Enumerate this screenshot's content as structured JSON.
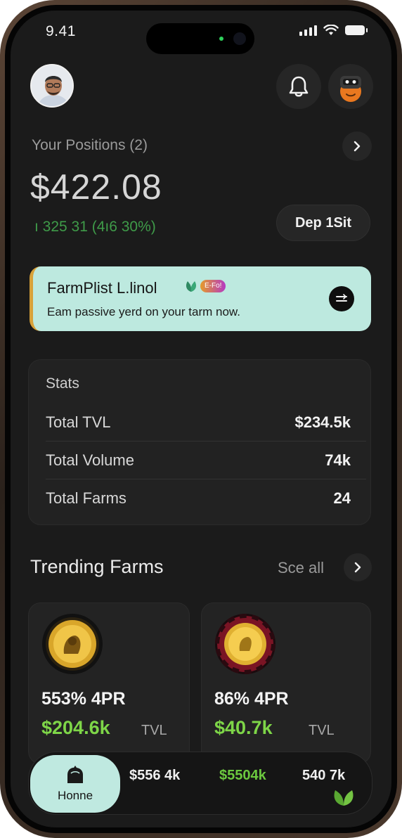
{
  "status_bar": {
    "time": "9.41"
  },
  "header": {
    "avatar_icon": "user-avatar",
    "bell_icon": "bell-icon",
    "profile_icon": "robot-avatar-icon"
  },
  "positions": {
    "label": "Your Positions (2)",
    "value": "$422.08",
    "change": "ı 325 31 (4ı6 30%)",
    "deposit_label": "Dep 1Sit"
  },
  "banner": {
    "title": "FarmPlist L.linol",
    "badge": "E-Fo!",
    "subtitle": "Eam passive yerd on your tarm now.",
    "background_color": "#bde9df",
    "accent_color": "#d8a23a"
  },
  "stats": {
    "title": "Stats",
    "rows": [
      {
        "label": "Total TVL",
        "value": "$234.5k"
      },
      {
        "label": "Total Volume",
        "value": "74k"
      },
      {
        "label": "Total Farms",
        "value": "24"
      }
    ]
  },
  "trending": {
    "title": "Trending Farms",
    "see_all": "Sce all",
    "farms": [
      {
        "apr": "553% 4PR",
        "tvl": "$204.6k",
        "tvl_label": "TVL",
        "coin_icon": "gold-coin-icon"
      },
      {
        "apr": "86% 4PR",
        "tvl": "$40.7k",
        "tvl_label": "TVL",
        "coin_icon": "gold-coin-red-ring-icon"
      }
    ],
    "positive_color": "#7ed648"
  },
  "bottom_nav": {
    "home_label": "Honne",
    "values": [
      "$556 4k",
      "$5504k",
      "540 7k"
    ],
    "leaf_icon": "leaf-icon"
  }
}
